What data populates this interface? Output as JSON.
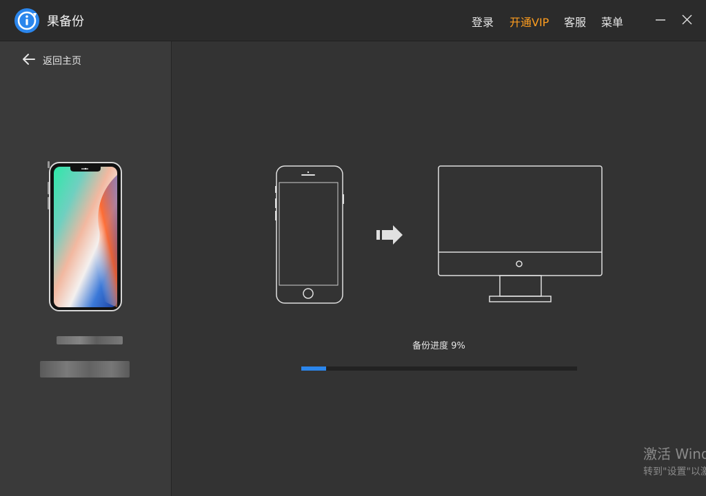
{
  "app": {
    "title": "果备份"
  },
  "topnav": {
    "login": "登录",
    "vip": "开通VIP",
    "support": "客服",
    "menu": "菜单"
  },
  "sidebar": {
    "back_label": "返回主页"
  },
  "main": {
    "progress_label": "备份进度 9%",
    "progress_percent": 9
  },
  "watermark": {
    "line1": "激活 Wind",
    "line2": "转到\"设置\"以激"
  },
  "colors": {
    "accent": "#2b86ec",
    "vip": "#ff9e1f",
    "background": "#333333",
    "sidebar": "#3a3a3a"
  }
}
